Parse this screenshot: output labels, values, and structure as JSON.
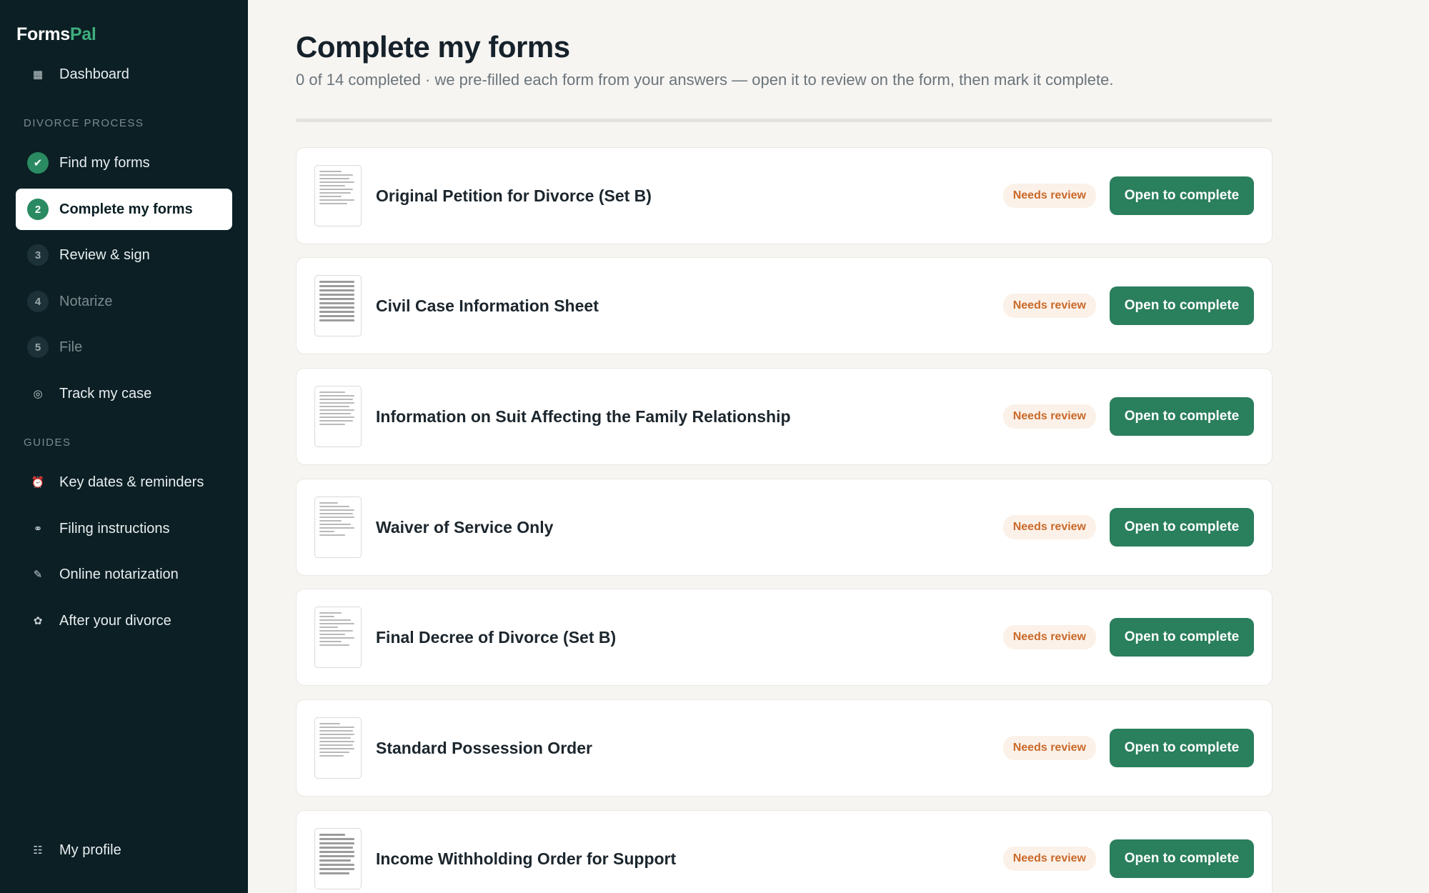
{
  "brand": {
    "name_part1": "Forms",
    "name_part2": "Pal"
  },
  "sidebar": {
    "dashboard_label": "Dashboard",
    "section_process": "DIVORCE PROCESS",
    "steps": [
      {
        "number": "",
        "label": "Find my forms",
        "state": "done"
      },
      {
        "number": "2",
        "label": "Complete my forms",
        "state": "active"
      },
      {
        "number": "3",
        "label": "Review & sign",
        "state": "upcoming"
      },
      {
        "number": "4",
        "label": "Notarize",
        "state": "locked"
      },
      {
        "number": "5",
        "label": "File",
        "state": "locked"
      }
    ],
    "track_label": "Track my case",
    "section_guides": "GUIDES",
    "guides": [
      {
        "label": "Key dates & reminders",
        "icon": "alarm-clock-icon"
      },
      {
        "label": "Filing instructions",
        "icon": "binoculars-icon"
      },
      {
        "label": "Online notarization",
        "icon": "pen-icon"
      },
      {
        "label": "After your divorce",
        "icon": "flower-icon"
      }
    ],
    "profile_label": "My profile"
  },
  "main": {
    "title": "Complete my forms",
    "subtitle": "0 of 14 completed · we pre-filled each form from your answers — open it to review on the form, then mark it complete.",
    "progress_fraction": 0,
    "forms": [
      {
        "name": "Original Petition for Divorce (Set B)",
        "status": "Needs review",
        "action": "Open to complete"
      },
      {
        "name": "Civil Case Information Sheet",
        "status": "Needs review",
        "action": "Open to complete"
      },
      {
        "name": "Information on Suit Affecting the Family Relationship",
        "status": "Needs review",
        "action": "Open to complete"
      },
      {
        "name": "Waiver of Service Only",
        "status": "Needs review",
        "action": "Open to complete"
      },
      {
        "name": "Final Decree of Divorce (Set B)",
        "status": "Needs review",
        "action": "Open to complete"
      },
      {
        "name": "Standard Possession Order",
        "status": "Needs review",
        "action": "Open to complete"
      },
      {
        "name": "Income Withholding Order for Support",
        "status": "Needs review",
        "action": "Open to complete"
      }
    ]
  },
  "colors": {
    "sidebar_bg": "#0b1f24",
    "accent_green": "#2a7f5d",
    "badge_text": "#c9692a",
    "badge_bg": "#fbf1e8"
  }
}
